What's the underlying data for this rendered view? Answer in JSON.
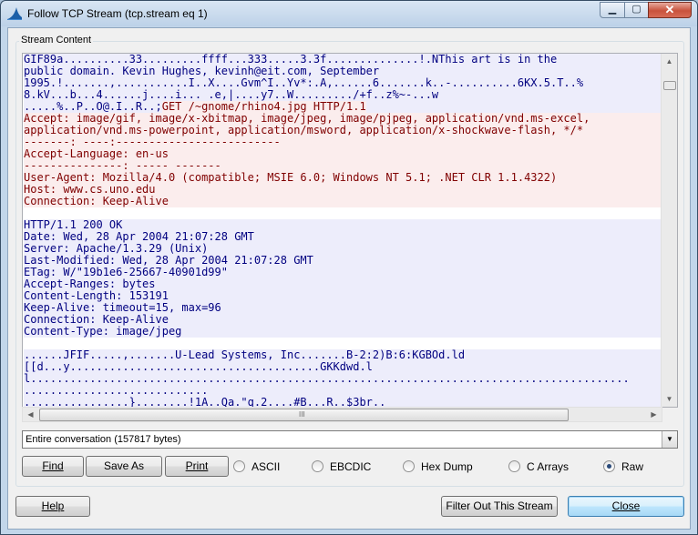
{
  "window": {
    "title": "Follow TCP Stream (tcp.stream eq 1)"
  },
  "titlebar_buttons": {
    "minimize": "▁",
    "maximize": "▢",
    "close": "✕"
  },
  "group": {
    "label": "Stream Content"
  },
  "stream_lines": [
    {
      "dir": "server",
      "text": "GIF89a..........33.........ffff...333.....3.3f..............!.NThis art is in the"
    },
    {
      "dir": "server",
      "text": "public domain. Kevin Hughes, kevinh@eit.com, September"
    },
    {
      "dir": "server",
      "text": "1995.!.......,...........I..X....Gvm^I..Yv*:.A,......6.......k..-..........6KX.5.T..%"
    },
    {
      "dir": "server",
      "text": "8.kV...b...4......j....i... .e,|....y7..W........./+f..z%~-...w"
    },
    {
      "dir": "server_then_client",
      "text": ".....%..P..O@.I..R..;",
      "text2": "GET /~gnome/rhino4.jpg HTTP/1.1"
    },
    {
      "dir": "client",
      "text": "Accept: image/gif, image/x-xbitmap, image/jpeg, image/pjpeg, application/vnd.ms-excel,"
    },
    {
      "dir": "client",
      "text": "application/vnd.ms-powerpoint, application/msword, application/x-shockwave-flash, */*"
    },
    {
      "dir": "client",
      "text": "-------: ----:-------------------------"
    },
    {
      "dir": "client",
      "text": "Accept-Language: en-us"
    },
    {
      "dir": "client",
      "text": "---------------: ----- -------"
    },
    {
      "dir": "client",
      "text": "User-Agent: Mozilla/4.0 (compatible; MSIE 6.0; Windows NT 5.1; .NET CLR 1.1.4322)"
    },
    {
      "dir": "client",
      "text": "Host: www.cs.uno.edu"
    },
    {
      "dir": "client",
      "text": "Connection: Keep-Alive"
    },
    {
      "dir": "blank",
      "text": ""
    },
    {
      "dir": "server",
      "text": "HTTP/1.1 200 OK"
    },
    {
      "dir": "server",
      "text": "Date: Wed, 28 Apr 2004 21:07:28 GMT"
    },
    {
      "dir": "server",
      "text": "Server: Apache/1.3.29 (Unix)"
    },
    {
      "dir": "server",
      "text": "Last-Modified: Wed, 28 Apr 2004 21:07:28 GMT"
    },
    {
      "dir": "server",
      "text": "ETag: W/\"19b1e6-25667-40901d99\""
    },
    {
      "dir": "server",
      "text": "Accept-Ranges: bytes"
    },
    {
      "dir": "server",
      "text": "Content-Length: 153191"
    },
    {
      "dir": "server",
      "text": "Keep-Alive: timeout=15, max=96"
    },
    {
      "dir": "server",
      "text": "Connection: Keep-Alive"
    },
    {
      "dir": "server",
      "text": "Content-Type: image/jpeg"
    },
    {
      "dir": "blank",
      "text": ""
    },
    {
      "dir": "server",
      "text": "......JFIF.....,.......U-Lead Systems, Inc.......B-2:2)B:6:KGBOd.ld"
    },
    {
      "dir": "server",
      "text": "[[d...y......................................GKKdwd.l"
    },
    {
      "dir": "server",
      "text": "l..........................................................................................."
    },
    {
      "dir": "server",
      "text": "............................"
    },
    {
      "dir": "server",
      "text": "................}........!1A..Qa.\"q.2....#B...R..$3br.."
    }
  ],
  "scroll": {
    "up": "▲",
    "down": "▼",
    "left": "◀",
    "right": "▶",
    "grip": "III"
  },
  "conversation_select": {
    "value": "Entire conversation (157817 bytes)",
    "arrow": "▼"
  },
  "buttons": {
    "find": "Find",
    "save_as": "Save As",
    "print": "Print",
    "help": "Help",
    "filter_out": "Filter Out This Stream",
    "close": "Close"
  },
  "formats": [
    {
      "label": "ASCII",
      "selected": false
    },
    {
      "label": "EBCDIC",
      "selected": false
    },
    {
      "label": "Hex Dump",
      "selected": false
    },
    {
      "label": "C Arrays",
      "selected": false
    },
    {
      "label": "Raw",
      "selected": true
    }
  ],
  "colors": {
    "client_text": "#800000",
    "client_bg": "#fbeded",
    "server_text": "#000080",
    "server_bg": "#ededfb"
  }
}
